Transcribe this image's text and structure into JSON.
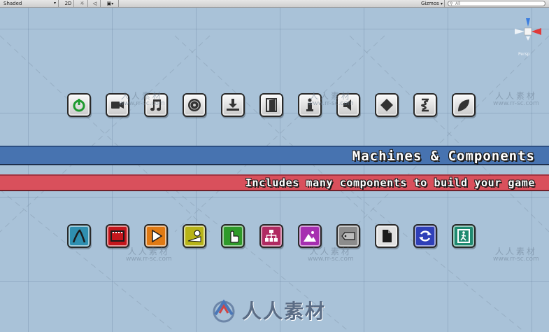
{
  "toolbar": {
    "shading_mode": "Shaded",
    "mode_2d": "2D",
    "gizmos_label": "Gizmos",
    "search_placeholder": "All"
  },
  "gizmo": {
    "projection_label": "Persp"
  },
  "icons_row1": [
    {
      "name": "power-icon"
    },
    {
      "name": "video-camera-icon"
    },
    {
      "name": "music-note-icon"
    },
    {
      "name": "sawblade-icon"
    },
    {
      "name": "download-icon"
    },
    {
      "name": "door-icon"
    },
    {
      "name": "info-icon"
    },
    {
      "name": "speaker-icon"
    },
    {
      "name": "diamond-icon"
    },
    {
      "name": "spring-icon"
    },
    {
      "name": "leaf-icon"
    }
  ],
  "icons_row2": [
    {
      "name": "path-icon",
      "color": "#2f8fb0"
    },
    {
      "name": "film-icon",
      "color": "#c4161c"
    },
    {
      "name": "play-icon",
      "color": "#e07a14"
    },
    {
      "name": "ball-ramp-icon",
      "color": "#b8b418"
    },
    {
      "name": "hand-pointer-icon",
      "color": "#2f9a2a"
    },
    {
      "name": "hierarchy-icon",
      "color": "#b02a62"
    },
    {
      "name": "image-icon",
      "color": "#a62fb0"
    },
    {
      "name": "tag-icon",
      "color": "#8c8c8c"
    },
    {
      "name": "document-icon",
      "color": "#e0e0e0"
    },
    {
      "name": "refresh-icon",
      "color": "#2f3fb8"
    },
    {
      "name": "exit-icon",
      "color": "#1f8a70"
    }
  ],
  "banner": {
    "title": "Machines & Components",
    "subtitle": "Includes many components to build your game"
  },
  "watermark": {
    "cn": "人人素材",
    "url": "www.rr-sc.com",
    "cn_big": "人人素材"
  },
  "colors": {
    "scene_bg": "#a9c2d8",
    "banner_blue": "#4773b0",
    "banner_red": "#d9505c"
  }
}
